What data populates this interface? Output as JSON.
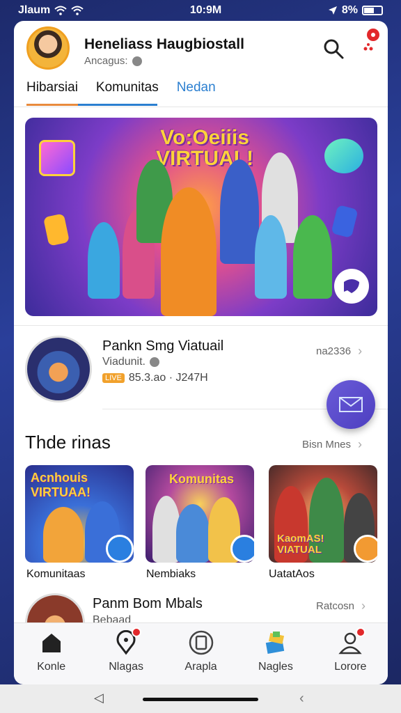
{
  "status_bar": {
    "carrier": "Jlaum",
    "time": "10:9M",
    "battery": "8%"
  },
  "header": {
    "profile_name": "Heneliass Haugbiostall",
    "profile_sub": "Ancagus:",
    "tabs": [
      {
        "label": "Hibarsiai"
      },
      {
        "label": "Komunitas"
      },
      {
        "label": "Nedan"
      }
    ]
  },
  "banner": {
    "title": "Vo:Oeiiis VIRTUAL!"
  },
  "feed_item": {
    "title": "Pankn Smg Viatuail",
    "subtitle": "Viadunit.",
    "meta_badge": "LIVE",
    "meta_text": "85.3.ao · J247H",
    "right_text": "na2336"
  },
  "section": {
    "title": "Thde rinas",
    "link": "Bisn Mnes"
  },
  "thumbnails": [
    {
      "overlay": "Acnhouis VIRTUAA!",
      "caption": "Komunitaas",
      "badge_color": "#2a7fe0"
    },
    {
      "overlay": "Komunitas",
      "caption": "Nembiaks",
      "badge_color": "#2a7fe0"
    },
    {
      "overlay": "KaomAS! VIATUAL",
      "caption": "UatatAos",
      "badge_color": "#f29a32"
    }
  ],
  "feed_item_2": {
    "title": "Panm Bom Mbals",
    "subtitle": "Bebaad",
    "right_text": "Ratcosn"
  },
  "bottom_nav": [
    {
      "label": "Konle",
      "icon": "home-icon"
    },
    {
      "label": "Nlagas",
      "icon": "map-pin-icon"
    },
    {
      "label": "Arapla",
      "icon": "tablet-icon"
    },
    {
      "label": "Nagles",
      "icon": "gift-icon"
    },
    {
      "label": "Lorore",
      "icon": "profile-icon"
    }
  ],
  "colors": {
    "accent_blue": "#2b7fd0",
    "accent_orange": "#e88a3c",
    "fab_purple": "#5b4ccf",
    "notification_red": "#e2282b"
  }
}
